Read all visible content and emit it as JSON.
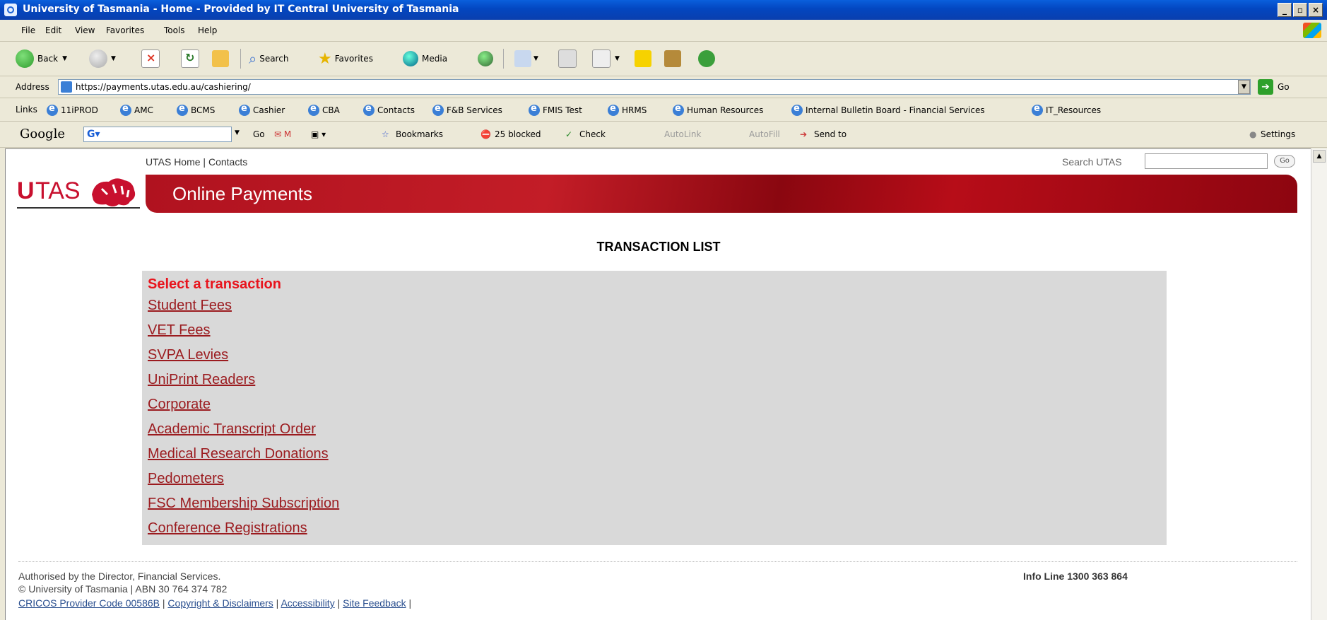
{
  "window": {
    "title": "University of Tasmania - Home - Provided by IT Central University of Tasmania"
  },
  "menu": [
    "File",
    "Edit",
    "View",
    "Favorites",
    "Tools",
    "Help"
  ],
  "toolbar": {
    "back_label": "Back",
    "search_label": "Search",
    "favorites_label": "Favorites",
    "media_label": "Media"
  },
  "address": {
    "label": "Address",
    "url": "https://payments.utas.edu.au/cashiering/",
    "go_label": "Go"
  },
  "links_bar": {
    "label": "Links",
    "items": [
      "11iPROD",
      "AMC",
      "BCMS",
      "Cashier",
      "CBA",
      "Contacts",
      "F&B Services",
      "FMIS Test",
      "HRMS",
      "Human Resources",
      "Internal Bulletin Board - Financial Services",
      "IT_Resources"
    ]
  },
  "google_bar": {
    "logo": "Google",
    "go_label": "Go",
    "bookmarks_label": "Bookmarks",
    "blocked_label": "25 blocked",
    "check_label": "Check",
    "autolink_label": "AutoLink",
    "autofill_label": "AutoFill",
    "sendto_label": "Send to",
    "settings_label": "Settings"
  },
  "page": {
    "top_links": {
      "home": "UTAS Home",
      "separator": " | ",
      "contacts": "Contacts"
    },
    "search_label": "Search UTAS",
    "search_go": "Go",
    "logo_u": "U",
    "logo_tas": "TAS",
    "banner_title": "Online Payments",
    "section_title": "TRANSACTION LIST",
    "panel_heading": "Select a transaction",
    "transactions": [
      "Student Fees",
      "VET Fees",
      "SVPA Levies",
      "UniPrint Readers",
      "Corporate",
      "Academic Transcript Order",
      "Medical Research Donations",
      "Pedometers",
      "FSC Membership Subscription",
      "Conference Registrations"
    ],
    "footer": {
      "line1": "Authorised by the Director, Financial Services.",
      "line2": "© University of Tasmania | ABN 30 764 374 782",
      "cricos": "CRICOS Provider Code 00586B",
      "copyright": "Copyright & Disclaimers",
      "accessibility": "Accessibility",
      "feedback": "Site Feedback",
      "sep": " | ",
      "info_line": "Info Line 1300 363 864"
    }
  },
  "colors": {
    "brand_red": "#c8102e",
    "link_red": "#9b1b1f",
    "heading_red": "#e8141d",
    "panel_grey": "#d9d9d9"
  }
}
